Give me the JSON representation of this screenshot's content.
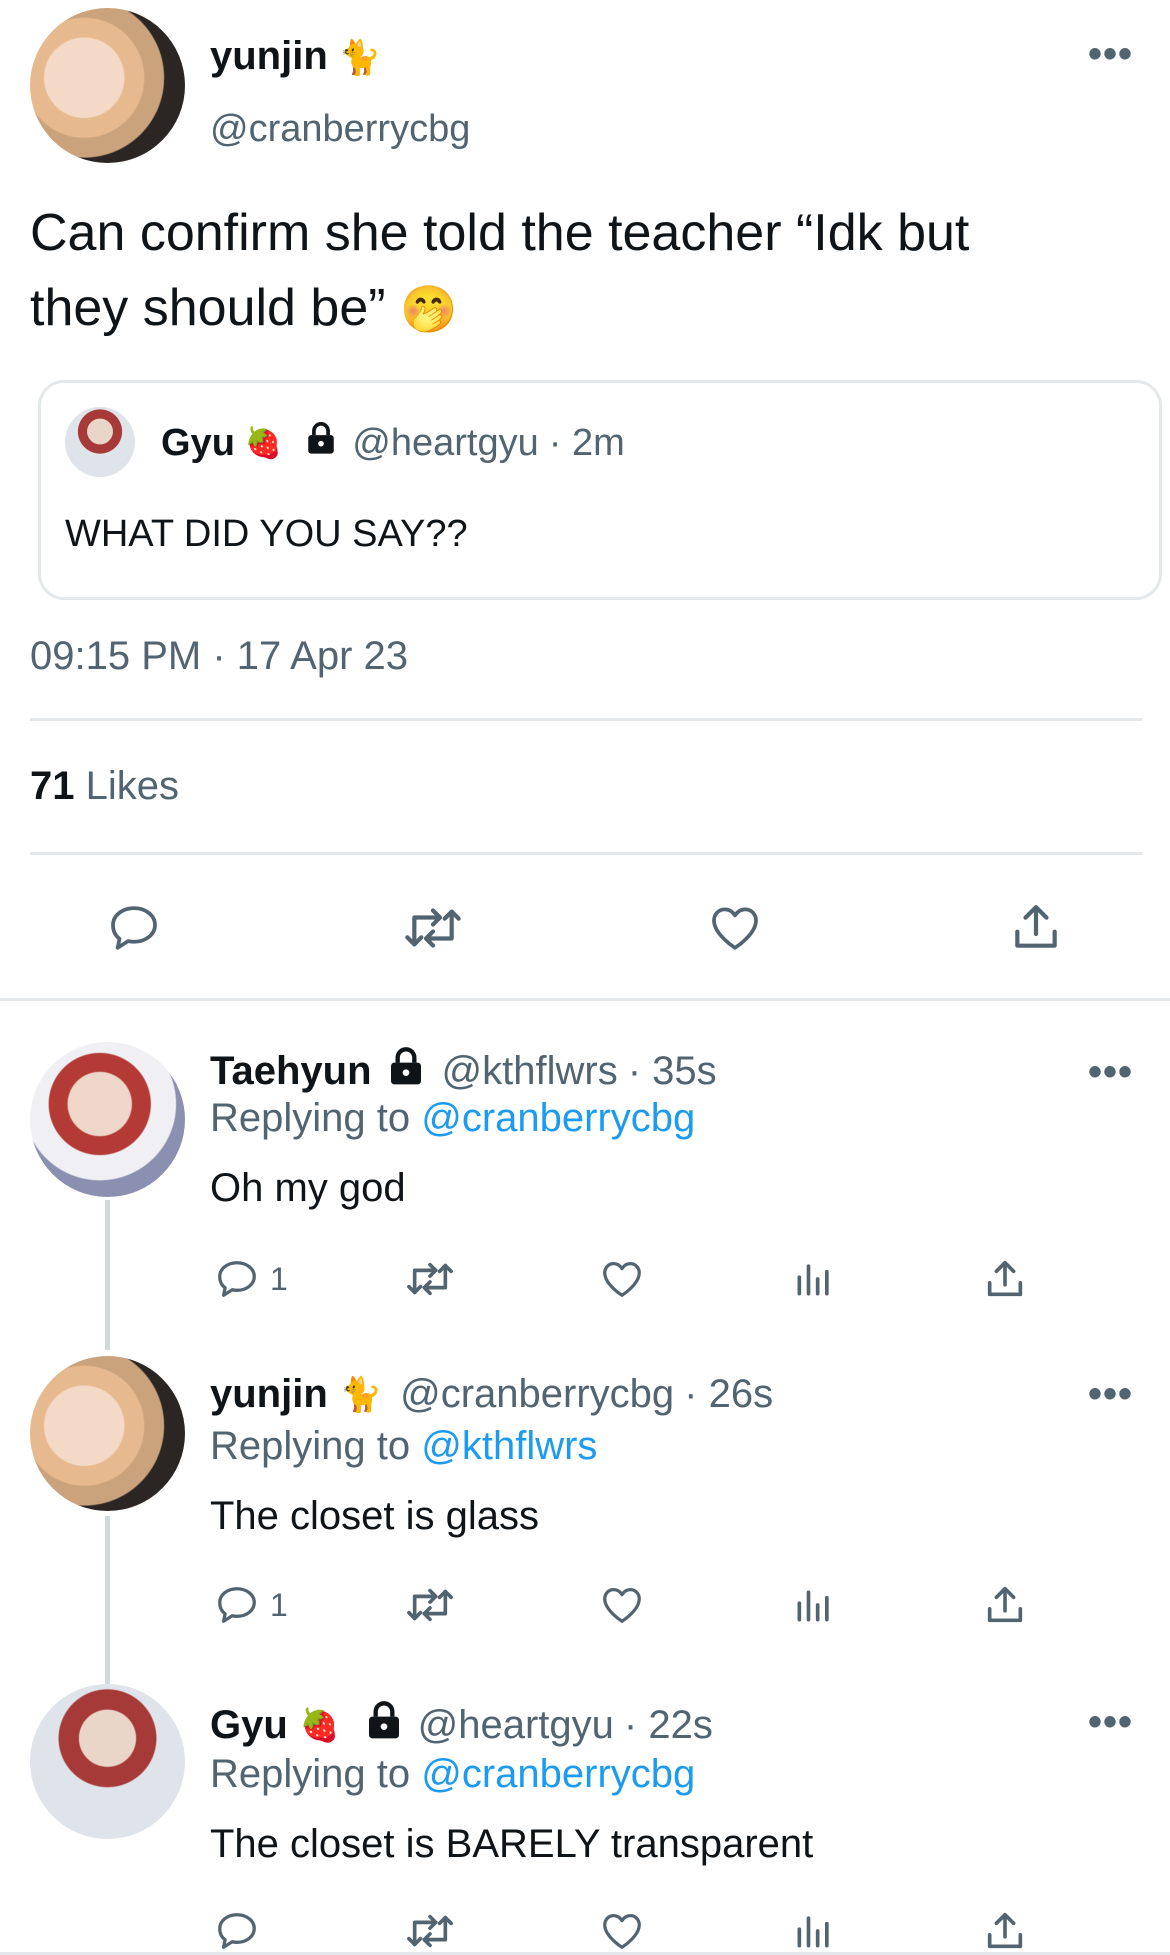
{
  "main_tweet": {
    "author_name": "yunjin",
    "author_emoji": "🐈",
    "handle": "@cranberrycbg",
    "text_line1": "Can confirm she told the teacher “Idk but",
    "text_line2": "they should be”",
    "emoji": "🤭",
    "quoted": {
      "author_name": "Gyu",
      "author_emoji": "🍓",
      "handle": "@heartgyu",
      "time": "· 2m",
      "text": "WHAT DID YOU SAY??"
    },
    "timestamp": "09:15 PM · 17 Apr 23",
    "likes_count": "71",
    "likes_label": "Likes"
  },
  "replies": [
    {
      "author_name": "Taehyun",
      "handle": "@kthflwrs",
      "time": "· 35s",
      "replying_prefix": "Replying to",
      "replying_to": "@cranberrycbg",
      "text": "Oh my god",
      "reply_count": "1"
    },
    {
      "author_name": "yunjin",
      "author_emoji": "🐈",
      "handle": "@cranberrycbg",
      "time": "· 26s",
      "replying_prefix": "Replying to",
      "replying_to": "@kthflwrs",
      "text": "The closet is glass",
      "reply_count": "1"
    },
    {
      "author_name": "Gyu",
      "author_emoji": "🍓",
      "handle": "@heartgyu",
      "time": "· 22s",
      "replying_prefix": "Replying to",
      "replying_to": "@cranberrycbg",
      "text": "The closet is BARELY transparent",
      "reply_count": ""
    }
  ],
  "icons": {
    "reply": "reply-icon",
    "retweet": "retweet-icon",
    "like": "heart-icon",
    "share": "share-icon",
    "views": "analytics-icon",
    "more": "more-icon",
    "lock": "lock-icon"
  },
  "colors": {
    "link": "#1d9bf0",
    "muted": "#536471",
    "divider": "#e4e8eb"
  }
}
